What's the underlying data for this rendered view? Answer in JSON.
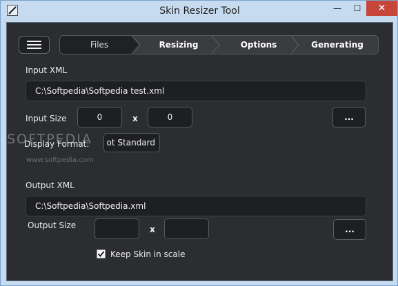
{
  "window": {
    "title": "Skin Resizer Tool",
    "minimize_glyph": "—",
    "maximize_glyph": "☐",
    "close_glyph": "✕"
  },
  "steps": [
    "Files",
    "Resizing",
    "Options",
    "Generating"
  ],
  "input": {
    "section_label": "Input XML",
    "path": "C:\\Softpedia\\Softpedia test.xml",
    "size_label": "Input Size",
    "width": "0",
    "height": "0",
    "times": "x",
    "browse": "...",
    "format_label": "Display Format:",
    "format_value": "ot Standard"
  },
  "output": {
    "section_label": "Output XML",
    "path": "C:\\Softpedia\\Softpedia.xml",
    "size_label": "Output Size",
    "width": "",
    "height": "",
    "times": "x",
    "browse": "...",
    "keep_scale_label": "Keep Skin in scale",
    "keep_scale_checked": true
  },
  "watermark": {
    "text": "SOFTPEDIA",
    "url": "www.softpedia.com"
  }
}
